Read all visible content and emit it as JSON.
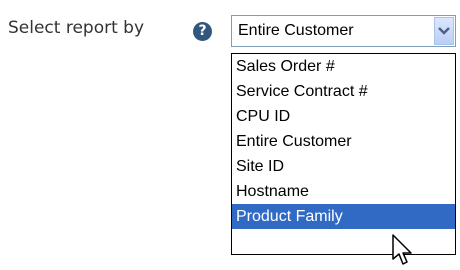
{
  "report_selector": {
    "label": "Select report by",
    "help_icon": "question-mark-circle-icon",
    "help_glyph": "?",
    "current_value": "Entire Customer",
    "arrow_icon": "chevron-down-icon",
    "options": [
      {
        "label": "Sales Order #",
        "highlighted": false
      },
      {
        "label": "Service Contract #",
        "highlighted": false
      },
      {
        "label": "CPU ID",
        "highlighted": false
      },
      {
        "label": "Entire Customer",
        "highlighted": false
      },
      {
        "label": "Site ID",
        "highlighted": false
      },
      {
        "label": "Hostname",
        "highlighted": false
      },
      {
        "label": "Product Family",
        "highlighted": true
      }
    ],
    "highlight_color": "#316ac5"
  },
  "cursor": {
    "icon": "pointer-cursor-icon"
  }
}
